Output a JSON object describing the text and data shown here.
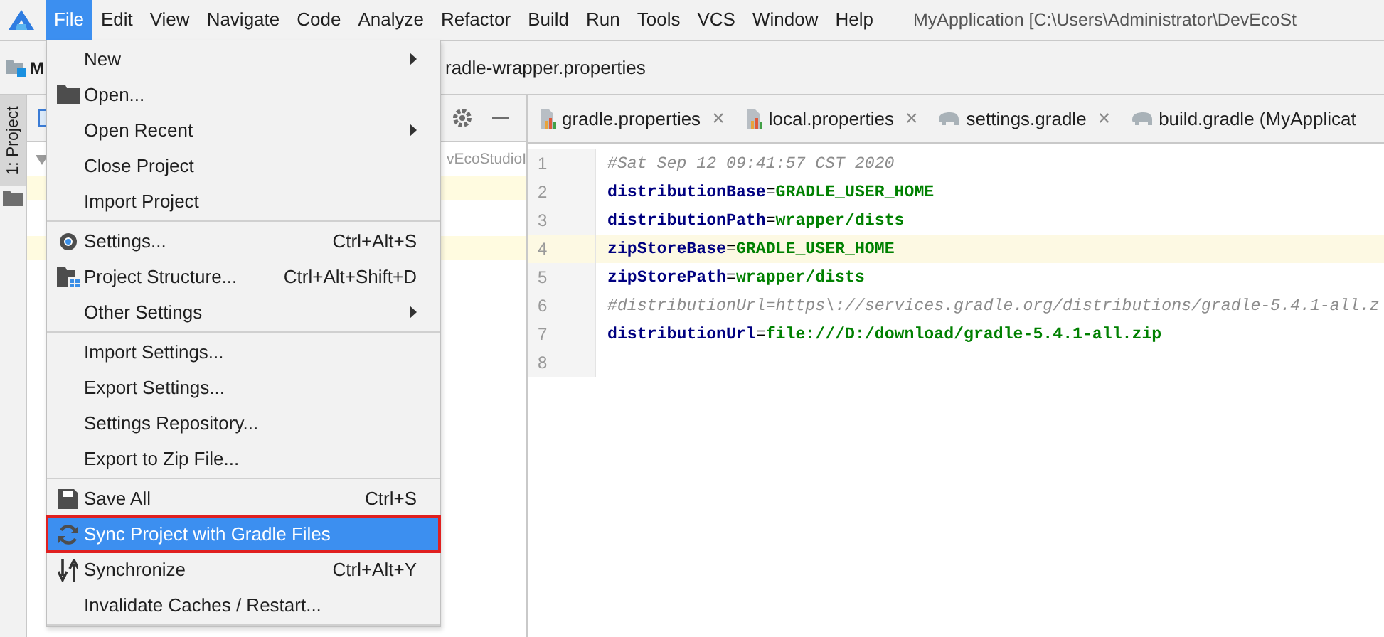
{
  "menubar": {
    "items": [
      {
        "label": "File",
        "selected": true
      },
      {
        "label": "Edit",
        "selected": false
      },
      {
        "label": "View",
        "selected": false
      },
      {
        "label": "Navigate",
        "selected": false
      },
      {
        "label": "Code",
        "selected": false
      },
      {
        "label": "Analyze",
        "selected": false
      },
      {
        "label": "Refactor",
        "selected": false
      },
      {
        "label": "Build",
        "selected": false
      },
      {
        "label": "Run",
        "selected": false
      },
      {
        "label": "Tools",
        "selected": false
      },
      {
        "label": "VCS",
        "selected": false
      },
      {
        "label": "Window",
        "selected": false
      },
      {
        "label": "Help",
        "selected": false
      }
    ],
    "title": "MyApplication [C:\\Users\\Administrator\\DevEcoSt"
  },
  "breadcrumb": {
    "project": "M",
    "file": "radle-wrapper.properties"
  },
  "tool_stripe": {
    "label": "1: Project"
  },
  "project_panel": {
    "path": "vEcoStudioI"
  },
  "tabs": [
    {
      "label": "gradle.properties",
      "kind": "properties",
      "close": "×"
    },
    {
      "label": "local.properties",
      "kind": "properties",
      "close": "×"
    },
    {
      "label": "settings.gradle",
      "kind": "gradle",
      "close": "×"
    },
    {
      "label": "build.gradle (MyApplicat",
      "kind": "gradle"
    }
  ],
  "editor": {
    "lines": [
      {
        "number": "1",
        "current": false,
        "tokens": [
          {
            "kind": "comment",
            "text": "#Sat Sep 12 09:41:57 CST 2020"
          }
        ]
      },
      {
        "number": "2",
        "current": false,
        "tokens": [
          {
            "kind": "key",
            "text": "distributionBase"
          },
          {
            "kind": "sep",
            "text": "="
          },
          {
            "kind": "value",
            "text": "GRADLE_USER_HOME"
          }
        ]
      },
      {
        "number": "3",
        "current": false,
        "tokens": [
          {
            "kind": "key",
            "text": "distributionPath"
          },
          {
            "kind": "sep",
            "text": "="
          },
          {
            "kind": "value",
            "text": "wrapper/dists"
          }
        ]
      },
      {
        "number": "4",
        "current": true,
        "tokens": [
          {
            "kind": "key",
            "text": "zipStoreBase"
          },
          {
            "kind": "sep",
            "text": "="
          },
          {
            "kind": "value",
            "text": "GRADLE_USER_HOME"
          }
        ]
      },
      {
        "number": "5",
        "current": false,
        "tokens": [
          {
            "kind": "key",
            "text": "zipStorePath"
          },
          {
            "kind": "sep",
            "text": "="
          },
          {
            "kind": "value",
            "text": "wrapper/dists"
          }
        ]
      },
      {
        "number": "6",
        "current": false,
        "tokens": [
          {
            "kind": "comment",
            "text": "#distributionUrl=https\\://services.gradle.org/distributions/gradle-5.4.1-all.z"
          }
        ]
      },
      {
        "number": "7",
        "current": false,
        "tokens": [
          {
            "kind": "key",
            "text": "distributionUrl"
          },
          {
            "kind": "sep",
            "text": "="
          },
          {
            "kind": "value",
            "text": "file:///D:/download/gradle-5.4.1-all.zip"
          }
        ]
      },
      {
        "number": "8",
        "current": false
      }
    ]
  },
  "file_menu": {
    "groups": [
      [
        {
          "label": "New",
          "submenu": true,
          "selected": false,
          "outlined": false
        },
        {
          "label": "Open...",
          "submenu": false,
          "selected": false,
          "outlined": false
        },
        {
          "label": "Open Recent",
          "submenu": true,
          "selected": false,
          "outlined": false
        },
        {
          "label": "Close Project",
          "submenu": false,
          "selected": false,
          "outlined": false
        },
        {
          "label": "Import Project",
          "submenu": false,
          "selected": false,
          "outlined": false
        }
      ],
      [
        {
          "label": "Settings...",
          "shortcut": "Ctrl+Alt+S",
          "submenu": false,
          "selected": false,
          "outlined": false
        },
        {
          "label": "Project Structure...",
          "shortcut": "Ctrl+Alt+Shift+D",
          "submenu": false,
          "selected": false,
          "outlined": false
        },
        {
          "label": "Other Settings",
          "submenu": true,
          "selected": false,
          "outlined": false
        }
      ],
      [
        {
          "label": "Import Settings...",
          "submenu": false,
          "selected": false,
          "outlined": false
        },
        {
          "label": "Export Settings...",
          "submenu": false,
          "selected": false,
          "outlined": false
        },
        {
          "label": "Settings Repository...",
          "submenu": false,
          "selected": false,
          "outlined": false
        },
        {
          "label": "Export to Zip File...",
          "submenu": false,
          "selected": false,
          "outlined": false
        }
      ],
      [
        {
          "label": "Save All",
          "shortcut": "Ctrl+S",
          "submenu": false,
          "selected": false,
          "outlined": false
        },
        {
          "label": "Sync Project with Gradle Files",
          "submenu": false,
          "selected": true,
          "outlined": true
        },
        {
          "label": "Synchronize",
          "shortcut": "Ctrl+Alt+Y",
          "submenu": false,
          "selected": false,
          "outlined": false
        },
        {
          "label": "Invalidate Caches / Restart...",
          "submenu": false,
          "selected": false,
          "outlined": false
        }
      ]
    ]
  }
}
